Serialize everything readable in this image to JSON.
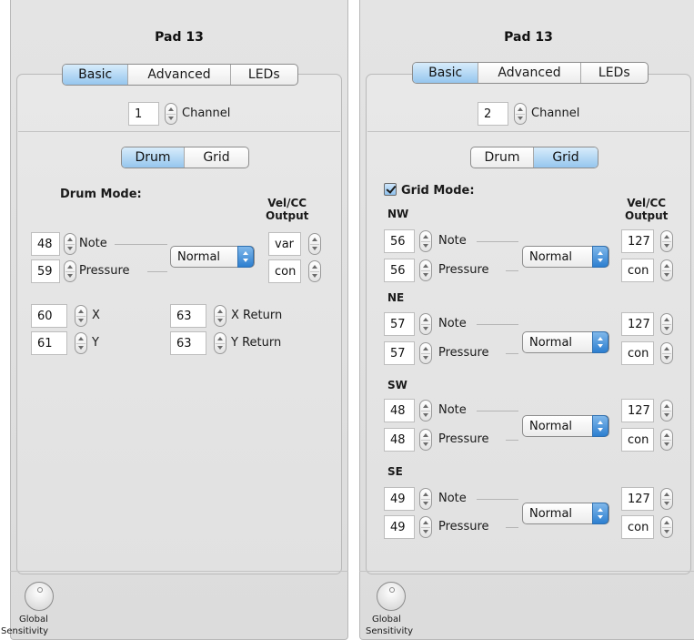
{
  "left": {
    "title": "Pad 13",
    "tabs": [
      "Basic",
      "Advanced",
      "LEDs"
    ],
    "active_tab": "Basic",
    "channel": {
      "value": "1",
      "label": "Channel"
    },
    "mode_tabs": [
      "Drum",
      "Grid"
    ],
    "active_mode": "Drum",
    "mode_heading": "Drum Mode:",
    "output_heading": "Vel/CC\nOutput",
    "note": {
      "value": "48",
      "label": "Note",
      "output": "var"
    },
    "pressure": {
      "value": "59",
      "label": "Pressure",
      "output": "con"
    },
    "select": "Normal",
    "x": {
      "value": "60",
      "label": "X"
    },
    "y": {
      "value": "61",
      "label": "Y"
    },
    "x_return": {
      "value": "63",
      "label": "X Return"
    },
    "y_return": {
      "value": "63",
      "label": "Y Return"
    },
    "knob_label_1": "Global",
    "knob_label_2": "Sensitivity"
  },
  "right": {
    "title": "Pad 13",
    "tabs": [
      "Basic",
      "Advanced",
      "LEDs"
    ],
    "active_tab": "Basic",
    "channel": {
      "value": "2",
      "label": "Channel"
    },
    "mode_tabs": [
      "Drum",
      "Grid"
    ],
    "active_mode": "Grid",
    "mode_heading": "Grid Mode:",
    "grid_mode_checked": true,
    "output_heading": "Vel/CC\nOutput",
    "groups": [
      {
        "name": "NW",
        "note": "56",
        "pressure": "56",
        "select": "Normal",
        "note_out": "127",
        "pressure_out": "con"
      },
      {
        "name": "NE",
        "note": "57",
        "pressure": "57",
        "select": "Normal",
        "note_out": "127",
        "pressure_out": "con"
      },
      {
        "name": "SW",
        "note": "48",
        "pressure": "48",
        "select": "Normal",
        "note_out": "127",
        "pressure_out": "con"
      },
      {
        "name": "SE",
        "note": "49",
        "pressure": "49",
        "select": "Normal",
        "note_out": "127",
        "pressure_out": "con"
      }
    ],
    "note_label": "Note",
    "pressure_label": "Pressure",
    "knob_label_1": "Global",
    "knob_label_2": "Sensitivity"
  }
}
